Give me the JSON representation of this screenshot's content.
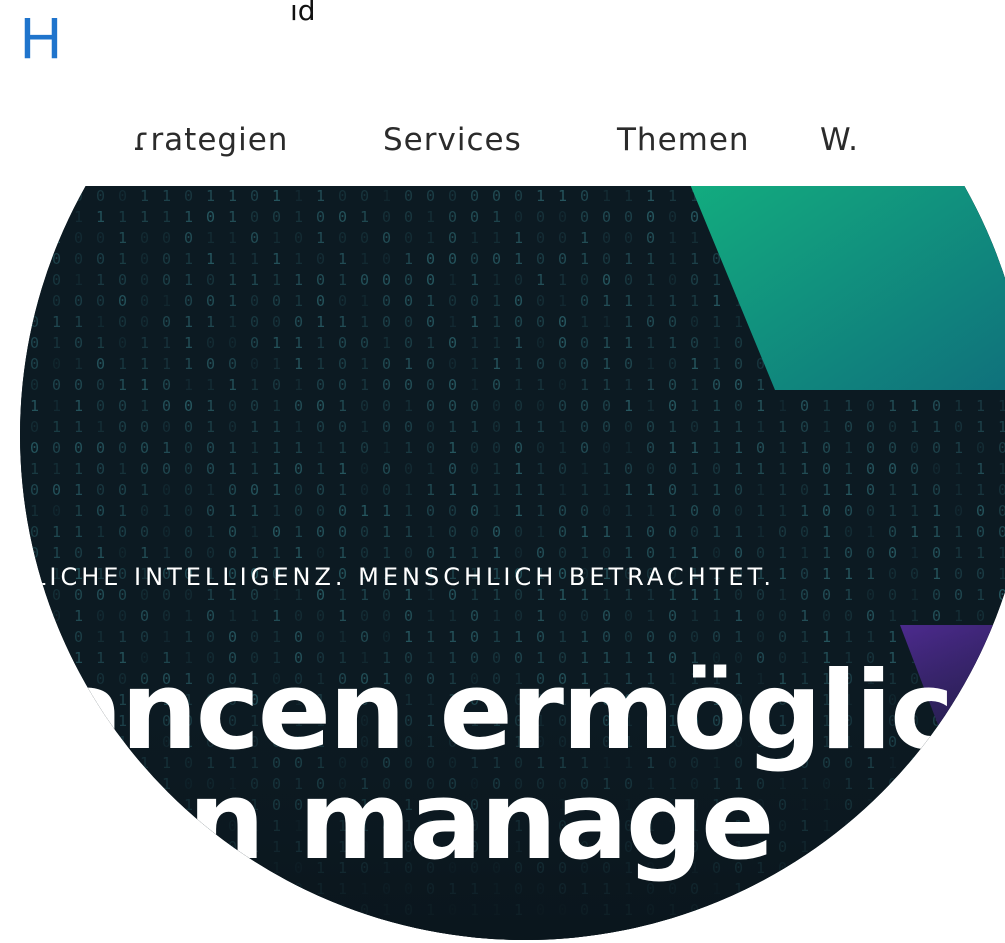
{
  "logo": {
    "letter": "H",
    "fragment": "ıd"
  },
  "nav": {
    "items": [
      {
        "label": "ɾrategien"
      },
      {
        "label": "Services"
      },
      {
        "label": "Themen"
      },
      {
        "label": "W."
      }
    ]
  },
  "hero": {
    "tagline": "LICHE INTELLIGENZ. MENSCHLICH BETRACHTET.",
    "headline_line1": "ancen ermöglic",
    "headline_line2": "ken manage",
    "colors": {
      "background": "#0c1a22",
      "accent_green": "#13b07f",
      "accent_purple": "#4b2a8c",
      "binary_text": "#2f6b74"
    }
  }
}
